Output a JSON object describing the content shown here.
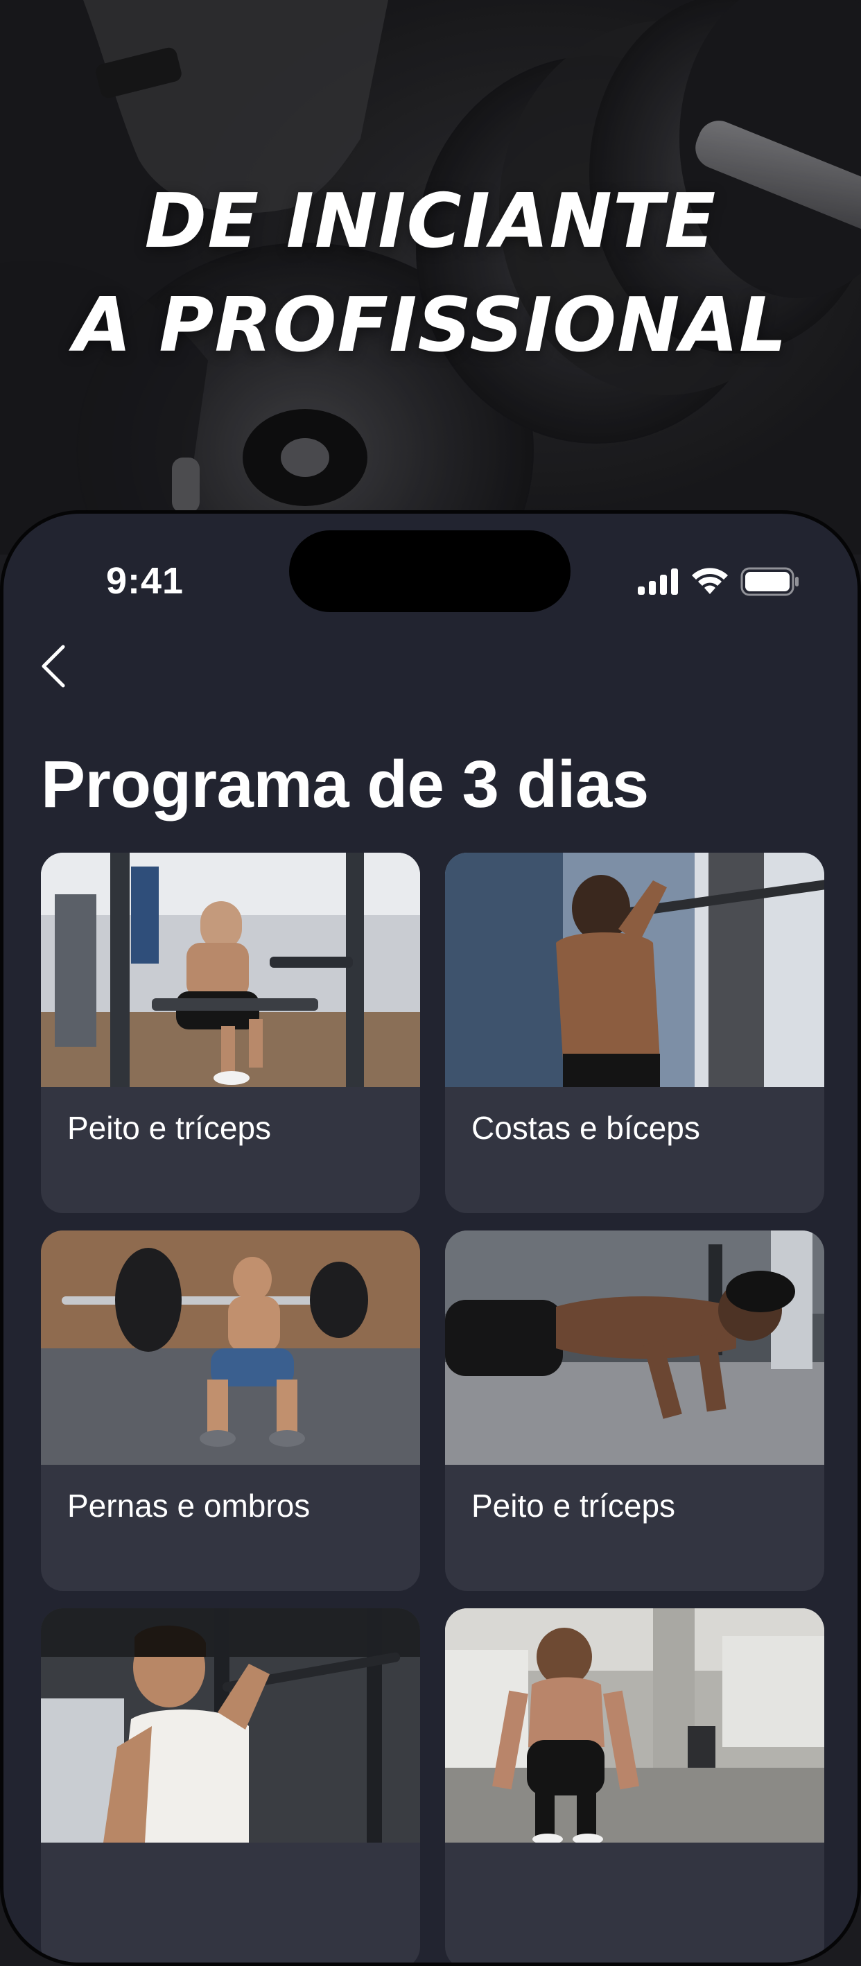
{
  "hero": {
    "headline_line1": "DE INICIANTE",
    "headline_line2": "A PROFISSIONAL"
  },
  "status_bar": {
    "time": "9:41",
    "icons": [
      "cellular-signal-icon",
      "wifi-icon",
      "battery-icon"
    ]
  },
  "nav": {
    "back_icon": "chevron-left-icon"
  },
  "page": {
    "title": "Programa de 3 dias"
  },
  "workouts": [
    {
      "label": "Peito e tríceps"
    },
    {
      "label": "Costas e bíceps"
    },
    {
      "label": "Pernas e ombros"
    },
    {
      "label": "Peito e tríceps"
    },
    {
      "label": ""
    },
    {
      "label": ""
    }
  ],
  "colors": {
    "background": "#222430",
    "card": "#333541",
    "text": "#ffffff"
  }
}
